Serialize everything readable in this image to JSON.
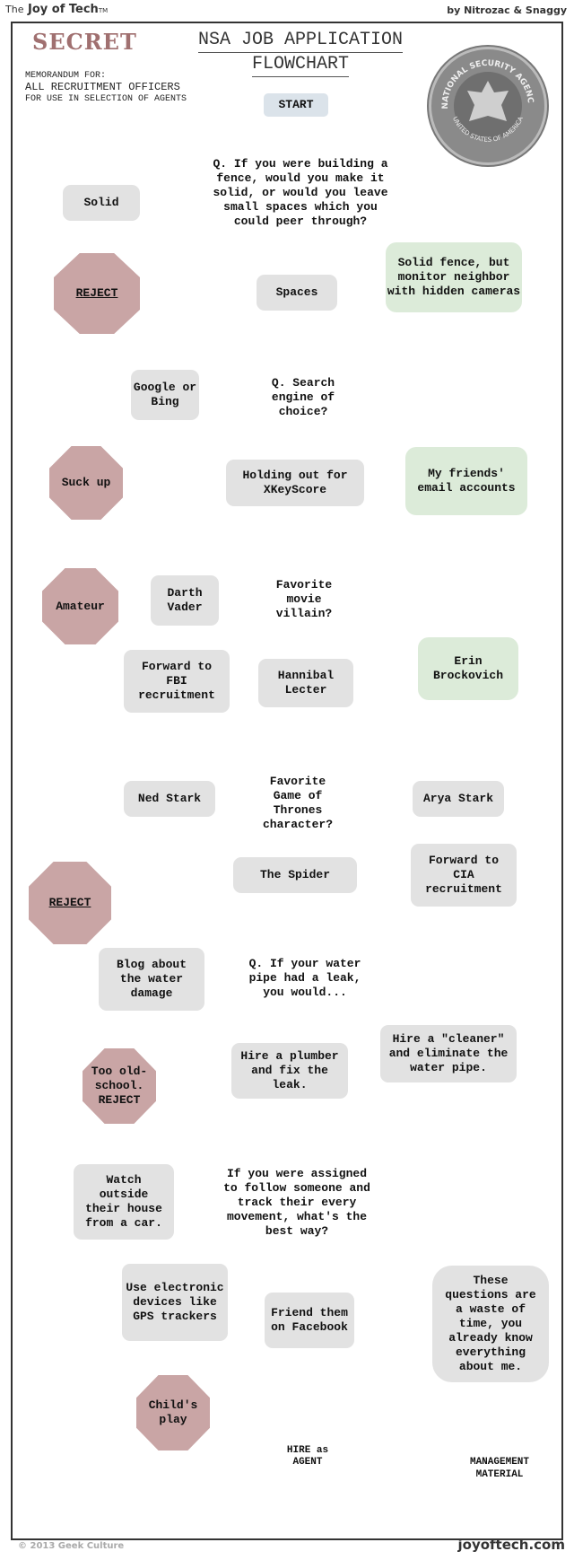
{
  "header": {
    "brand_prefix": "The",
    "brand_name": "Joy of Tech",
    "brand_tm": "TM",
    "byline": "by Nitrozac & Snaggy"
  },
  "memo": {
    "stamp": "SECRET",
    "title_line1": "NSA JOB APPLICATION",
    "title_line2": "FLOWCHART",
    "memo_for": "MEMORANDUM FOR:",
    "recipients": "ALL RECRUITMENT OFFICERS",
    "purpose": "FOR USE IN SELECTION OF AGENTS",
    "seal_top": "NATIONAL SECURITY AGENCY",
    "seal_bottom": "UNITED STATES OF AMERICA"
  },
  "colors": {
    "reject": "#c9a5a5",
    "answer": "#e2e2e2",
    "good_answer": "#dcebd9",
    "question": "#f6d2d2",
    "start": "#dbe3ea",
    "star_hire": "#e8e49a",
    "star_mgmt": "#f6df96",
    "arrow": "#707070"
  },
  "flow": {
    "start": "START",
    "q1": {
      "question": "Q. If you were building a fence, would you make it solid, or would you leave small spaces which you could peer through?",
      "solid": "Solid",
      "spaces": "Spaces",
      "reject": "REJECT",
      "good": "Solid fence, but monitor neighbor with hidden cameras"
    },
    "q2": {
      "question": "Q. Search engine of choice?",
      "google": "Google or Bing",
      "xkeyscore": "Holding out for XKeyScore",
      "suck_up": "Suck up",
      "good": "My friends' email accounts"
    },
    "q3": {
      "question": "Favorite movie villain?",
      "vader": "Darth Vader",
      "amateur": "Amateur",
      "hannibal": "Hannibal Lecter",
      "fbi": "Forward to FBI recruitment",
      "good": "Erin Brockovich"
    },
    "q4": {
      "question": "Favorite Game of Thrones character?",
      "ned": "Ned Stark",
      "reject": "REJECT",
      "spider": "The Spider",
      "arya": "Arya Stark",
      "cia": "Forward to CIA recruitment"
    },
    "q5": {
      "question": "Q. If your water pipe had a leak, you would...",
      "blog": "Blog about the water damage",
      "plumber": "Hire a plumber and fix the leak.",
      "old_school": "Too old-school. REJECT",
      "cleaner": "Hire a \"cleaner\" and eliminate the water pipe."
    },
    "q6": {
      "question": "If you were assigned to follow someone and track their every movement, what's the best way?",
      "watch": "Watch outside their house from a car.",
      "gps": "Use electronic devices like GPS trackers",
      "childs_play": "Child's play",
      "facebook": "Friend them on Facebook",
      "hire": "HIRE as AGENT",
      "waste": "These questions are a waste of time, you already know everything about me.",
      "management": "MANAGEMENT MATERIAL"
    }
  },
  "footer": {
    "copyright": "© 2013 Geek Culture",
    "site": "joyoftech.com"
  }
}
